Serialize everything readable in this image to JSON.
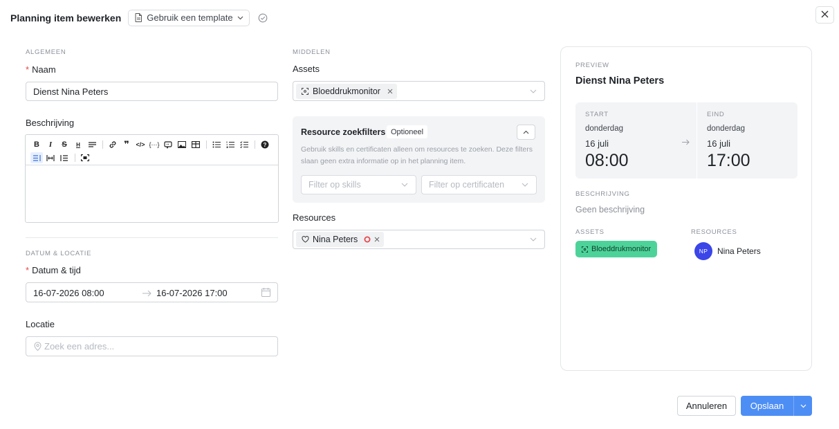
{
  "header": {
    "title": "Planning item bewerken",
    "template_button": "Gebruik een template"
  },
  "general": {
    "section": "ALGEMEEN",
    "name_label": "Naam",
    "name_value": "Dienst Nina Peters",
    "description_label": "Beschrijving"
  },
  "date_location": {
    "section": "DATUM & LOCATIE",
    "datetime_label": "Datum & tijd",
    "start_value": "16-07-2026 08:00",
    "end_value": "16-07-2026 17:00",
    "location_label": "Locatie",
    "location_placeholder": "Zoek een adres..."
  },
  "resources_section": {
    "section": "MIDDELEN",
    "assets_label": "Assets",
    "asset_chip": "Bloeddrukmonitor",
    "filter_title": "Resource zoekfilters",
    "filter_badge": "Optioneel",
    "filter_help": "Gebruik skills en certificaten alleen om resources te zoeken. Deze filters slaan geen extra informatie op in het planning item.",
    "skills_placeholder": "Filter op skills",
    "certs_placeholder": "Filter op certificaten",
    "resources_label": "Resources",
    "resource_chip": "Nina Peters"
  },
  "preview": {
    "section": "PREVIEW",
    "name": "Dienst Nina Peters",
    "start_label": "START",
    "start_day": "donderdag",
    "start_date": "16 juli",
    "start_time": "08:00",
    "end_label": "EIND",
    "end_day": "donderdag",
    "end_date": "16 juli",
    "end_time": "17:00",
    "description_label": "BESCHRIJVING",
    "description_value": "Geen beschrijving",
    "assets_label": "ASSETS",
    "asset_badge": "Bloeddrukmonitor",
    "resources_label": "RESOURCES",
    "resource_initials": "NP",
    "resource_name": "Nina Peters"
  },
  "footer": {
    "cancel": "Annuleren",
    "save": "Opslaan"
  },
  "colors": {
    "primary": "#4d8ef5",
    "asset_green": "#4dd39a",
    "avatar_blue": "#3b45e8",
    "required_red": "#e5484d"
  }
}
